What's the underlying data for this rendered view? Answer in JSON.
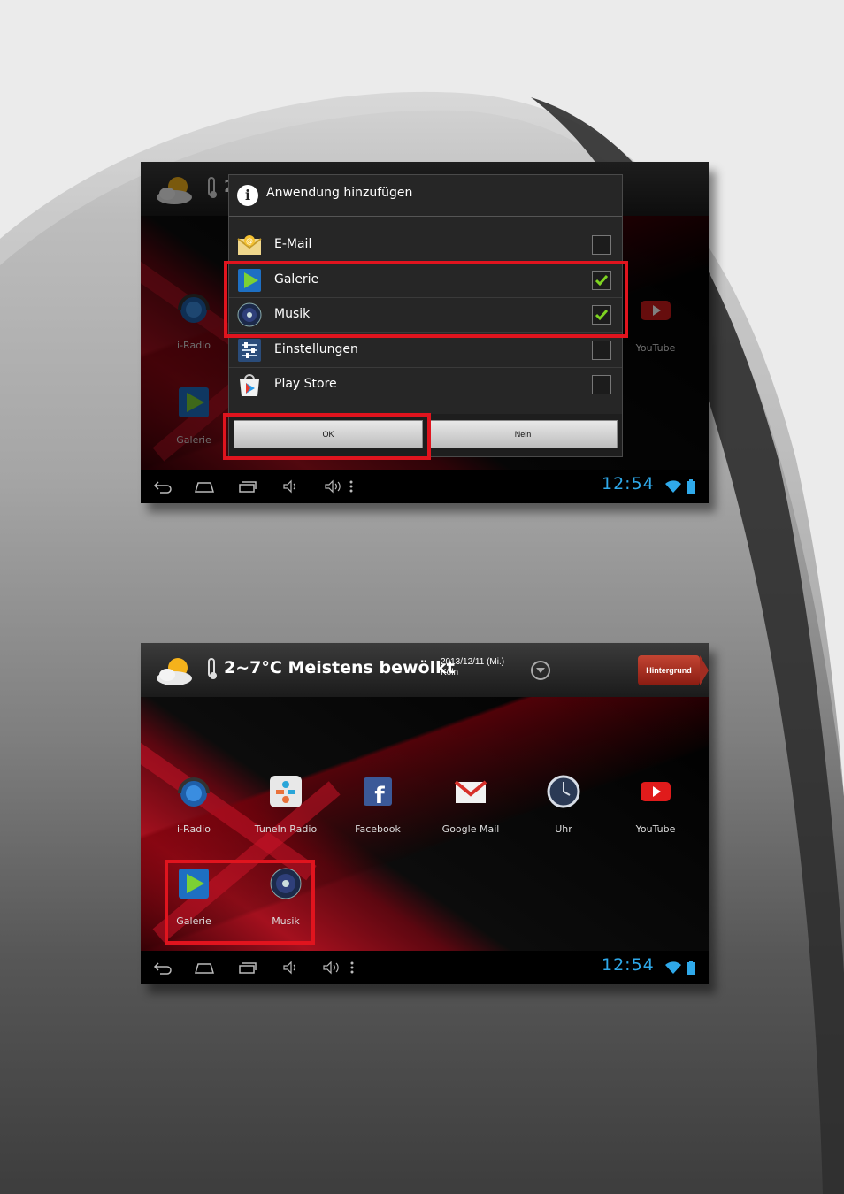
{
  "dialog_screen": {
    "dialog": {
      "title": "Anwendung hinzufügen",
      "items": [
        {
          "label": "E-Mail",
          "icon": "email-app-icon",
          "checked": false
        },
        {
          "label": "Galerie",
          "icon": "gallery-app-icon",
          "checked": true
        },
        {
          "label": "Musik",
          "icon": "music-app-icon",
          "checked": true
        },
        {
          "label": "Einstellungen",
          "icon": "settings-app-icon",
          "checked": false
        },
        {
          "label": "Play Store",
          "icon": "play-store-icon",
          "checked": false
        }
      ],
      "ok_label": "OK",
      "cancel_label": "Nein"
    },
    "background_apps": [
      {
        "label": "i-Radio"
      },
      {
        "label": "YouTube"
      },
      {
        "label": "Galerie"
      }
    ],
    "partial_temp": "2"
  },
  "home_screen": {
    "weather": {
      "temp": "2~7°C",
      "condition": "Meistens bewölkt",
      "date": "2013/12/11 (Mi.)",
      "city": "Köln"
    },
    "background_button": "Hintergrund",
    "apps": [
      {
        "label": "i-Radio"
      },
      {
        "label": "TuneIn Radio"
      },
      {
        "label": "Facebook"
      },
      {
        "label": "Google Mail"
      },
      {
        "label": "Uhr"
      },
      {
        "label": "YouTube"
      },
      {
        "label": "Galerie"
      },
      {
        "label": "Musik"
      }
    ]
  },
  "status": {
    "time": "12:54"
  },
  "colors": {
    "highlight": "#e0141e",
    "clock": "#2fa9ea",
    "check": "#7ed321"
  }
}
